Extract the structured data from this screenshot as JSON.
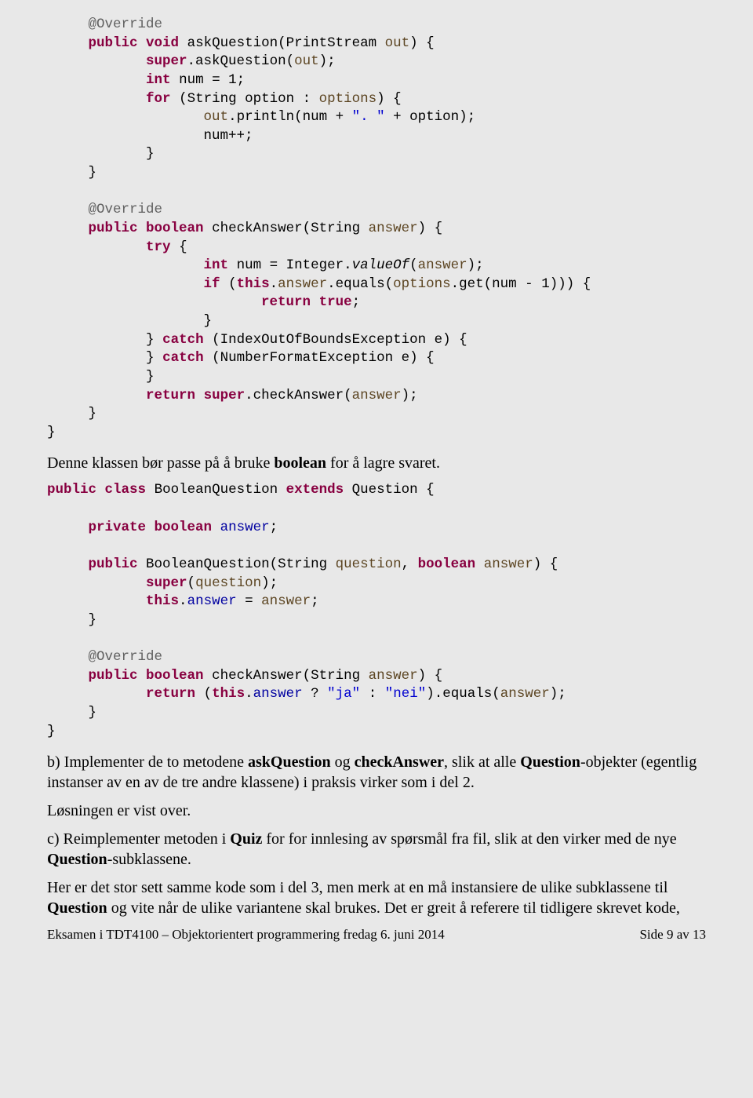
{
  "code1": {
    "l01a": "@Override",
    "l02a": "public",
    "l02b": "void",
    "l02c": "askQuestion(PrintStream",
    "l02d": "out",
    "l02e": ") {",
    "l03a": "super",
    "l03b": ".askQuestion(",
    "l03c": "out",
    "l03d": ");",
    "l04a": "int",
    "l04b": "num = 1;",
    "l05a": "for",
    "l05b": "(String option :",
    "l05c": "options",
    "l05d": ") {",
    "l06a": "out",
    "l06b": ".println(num +",
    "l06c": "\". \"",
    "l06d": "+ option);",
    "l07": "num++;",
    "l08": "}",
    "l09": "}",
    "l10a": "@Override",
    "l11a": "public",
    "l11b": "boolean",
    "l11c": "checkAnswer(String",
    "l11d": "answer",
    "l11e": ") {",
    "l12a": "try",
    "l12b": "{",
    "l13a": "int",
    "l13b": "num = Integer.",
    "l13c": "valueOf",
    "l13d": "(",
    "l13e": "answer",
    "l13f": ");",
    "l14a": "if",
    "l14b": "(",
    "l14c": "this",
    "l14d": ".",
    "l14e": "answer",
    "l14f": ".equals(",
    "l14g": "options",
    "l14h": ".get(num - 1))) {",
    "l15a": "return",
    "l15b": "true",
    "l15c": ";",
    "l16": "}",
    "l17a": "}",
    "l17b": "catch",
    "l17c": "(IndexOutOfBoundsException e) {",
    "l18a": "}",
    "l18b": "catch",
    "l18c": "(NumberFormatException e) {",
    "l19": "}",
    "l20a": "return",
    "l20b": "super",
    "l20c": ".checkAnswer(",
    "l20d": "answer",
    "l20e": ");",
    "l21": "}",
    "l22": "}"
  },
  "para1a": "Denne klassen bør passe på å bruke ",
  "para1b": "boolean",
  "para1c": " for å lagre svaret.",
  "code2": {
    "l01a": "public",
    "l01b": "class",
    "l01c": "BooleanQuestion",
    "l01d": "extends",
    "l01e": "Question {",
    "l02a": "private",
    "l02b": "boolean",
    "l02c": "answer",
    "l02d": ";",
    "l03a": "public",
    "l03b": "BooleanQuestion(String",
    "l03c": "question",
    "l03d": ",",
    "l03e": "boolean",
    "l03f": "answer",
    "l03g": ") {",
    "l04a": "super",
    "l04b": "(",
    "l04c": "question",
    "l04d": ");",
    "l05a": "this",
    "l05b": ".",
    "l05c": "answer",
    "l05d": " =",
    "l05e": "answer",
    "l05f": ";",
    "l06": "}",
    "l07a": "@Override",
    "l08a": "public",
    "l08b": "boolean",
    "l08c": "checkAnswer(String",
    "l08d": "answer",
    "l08e": ") {",
    "l09a": "return",
    "l09b": "(",
    "l09c": "this",
    "l09d": ".",
    "l09e": "answer",
    "l09f": " ?",
    "l09g": "\"ja\"",
    "l09h": ":",
    "l09i": "\"nei\"",
    "l09j": ").equals(",
    "l09k": "answer",
    "l09l": ");",
    "l10": "}",
    "l11": "}"
  },
  "para2a": "b) Implementer de to metodene ",
  "para2b": "askQuestion",
  "para2c": " og ",
  "para2d": "checkAnswer",
  "para2e": ", slik at alle ",
  "para2f": "Question",
  "para2g": "-objekter (egentlig instanser av en av de tre andre klassene) i praksis virker som i del 2.",
  "para3": "Løsningen er vist over.",
  "para4a": "c) Reimplementer metoden i ",
  "para4b": "Quiz",
  "para4c": " for for innlesing av spørsmål fra fil, slik at den virker med de nye ",
  "para4d": "Question",
  "para4e": "-subklassene.",
  "para5a": "Her er det stor sett samme kode som i del 3, men merk at en må instansiere de ulike subklassene til ",
  "para5b": "Question",
  "para5c": " og vite når de ulike variantene skal brukes. Det er greit å referere til tidligere skrevet kode,",
  "footerLeft": "Eksamen i TDT4100 – Objektorientert programmering fredag 6. juni 2014",
  "footerRight": "Side 9 av 13"
}
